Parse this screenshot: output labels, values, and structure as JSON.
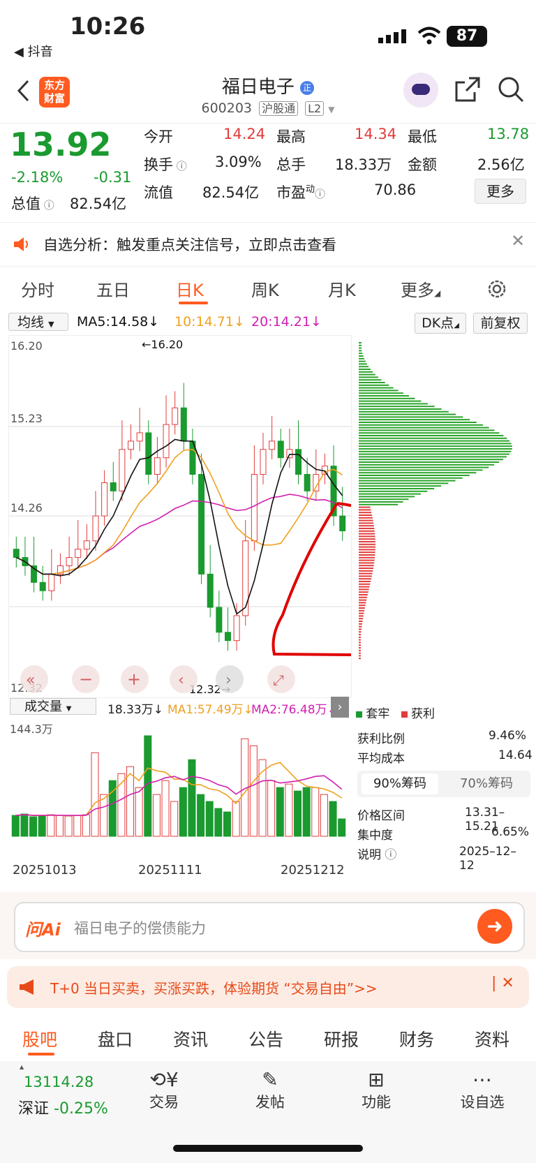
{
  "status": {
    "time": "10:26",
    "back_app": "◀ 抖音",
    "battery": "87"
  },
  "header": {
    "logo": "东方\n财富",
    "title": "福日电子",
    "code": "600203",
    "tag1": "沪股通",
    "tag2": "L2"
  },
  "quote": {
    "price": "13.92",
    "pct": "-2.18%",
    "change": "-0.31",
    "open_label": "今开",
    "open": "14.24",
    "high_label": "最高",
    "high": "14.34",
    "low_label": "最低",
    "low": "13.78",
    "turnover_label": "换手",
    "turnover": "3.09%",
    "vol_label": "总手",
    "vol": "18.33万",
    "amount_label": "金额",
    "amount": "2.56亿",
    "mcap_label": "总值",
    "mcap": "82.54亿",
    "float_label": "流值",
    "float": "82.54亿",
    "pe_label": "市盈",
    "pe": "70.86",
    "more": "更多"
  },
  "banner": {
    "text": "自选分析：触发重点关注信号，立即点击查看"
  },
  "tabs": [
    "分时",
    "五日",
    "日K",
    "周K",
    "月K",
    "更多"
  ],
  "ma": {
    "selector": "均线",
    "ma5": "MA5:14.58↓",
    "ma10": "10:14.71↓",
    "ma20": "20:14.21↓",
    "dk": "DK点",
    "fq": "前复权"
  },
  "chart_data": {
    "type": "candlestick",
    "price_ticks": [
      "16.20",
      "15.23",
      "14.26",
      "12.32"
    ],
    "high_mark": "←16.20",
    "low_mark": "12.32→",
    "ylim": [
      12.32,
      16.2
    ],
    "volume_label": "成交量",
    "volume_value": "18.33万↓",
    "vol_ma1": "MA1:57.49万↓",
    "vol_ma2": "MA2:76.48万↓",
    "vol_max": "144.3万",
    "dates": [
      "20251013",
      "20251111",
      "20251212"
    ]
  },
  "side": {
    "legend_hold": "套牢",
    "legend_profit": "获利",
    "profit_ratio_label": "获利比例",
    "profit_ratio": "9.46%",
    "avg_cost_label": "平均成本",
    "avg_cost": "14.64",
    "tab90": "90%筹码",
    "tab70": "70%筹码",
    "range_label": "价格区间",
    "range": "13.31–15.21",
    "conc_label": "集中度",
    "conc": "6.65%",
    "note_label": "说明",
    "note": "2025–12–12"
  },
  "qa": {
    "brand": "问Ai",
    "placeholder": "福日电子的偿债能力"
  },
  "promo": {
    "text": "T+0 当日买卖，买涨买跌，体验期货 “交易自由”>>"
  },
  "bottom_tabs": [
    "股吧",
    "盘口",
    "资讯",
    "公告",
    "研报",
    "财务",
    "资料"
  ],
  "dock": {
    "index_value": "13114.28",
    "index_name": "深证",
    "index_change": "-0.25%",
    "trade": "交易",
    "post": "发帖",
    "func": "功能",
    "watch": "设自选"
  }
}
